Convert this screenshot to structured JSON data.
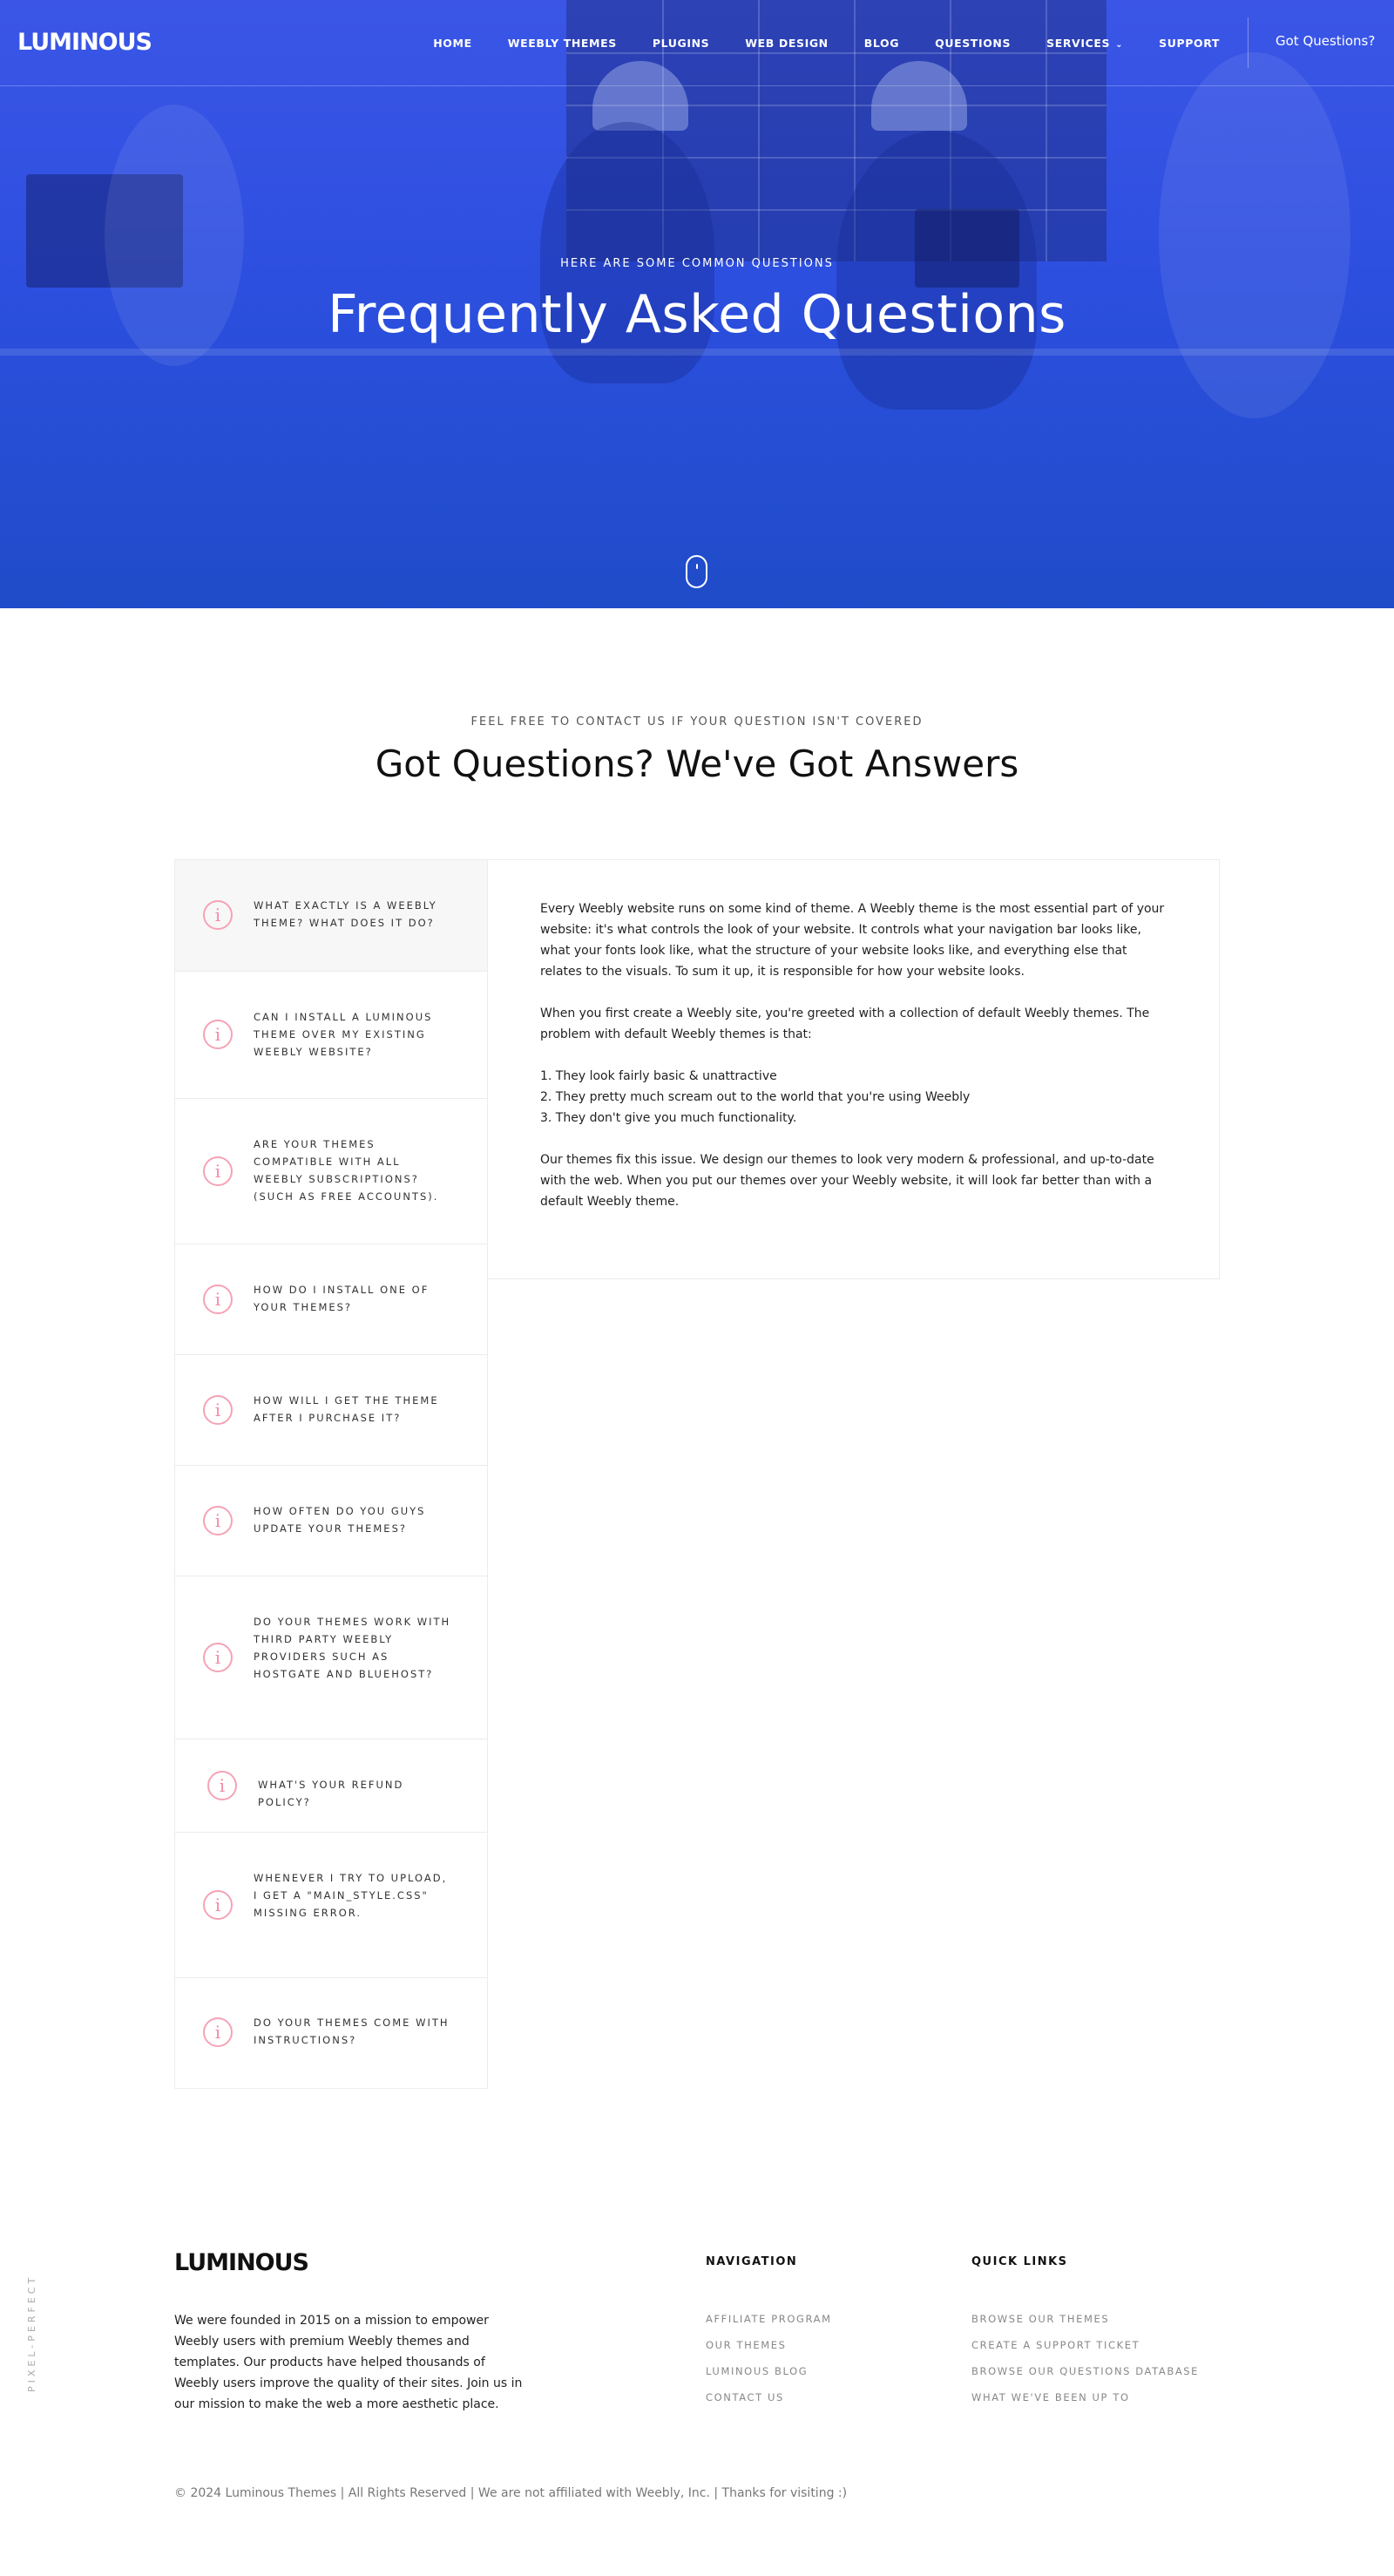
{
  "colors": {
    "hero_gradient_top": "#3b56e6",
    "hero_gradient_bottom": "#1f4cc8",
    "accent_icon": "#f28aa3",
    "text_dark": "#111111",
    "text_muted": "#888888"
  },
  "brand": {
    "logo_text": "LUMINOUS"
  },
  "nav": {
    "items": [
      {
        "label": "HOME"
      },
      {
        "label": "WEEBLY THEMES"
      },
      {
        "label": "PLUGINS"
      },
      {
        "label": "WEB DESIGN"
      },
      {
        "label": "BLOG"
      },
      {
        "label": "QUESTIONS"
      },
      {
        "label": "SERVICES",
        "icon": "chevron-down-icon"
      },
      {
        "label": "SUPPORT"
      }
    ],
    "cta": "Got Questions?"
  },
  "hero": {
    "eyebrow": "HERE ARE SOME COMMON QUESTIONS",
    "title": "Frequently Asked Questions",
    "scroll_icon": "mouse-scroll-icon"
  },
  "faq_section": {
    "eyebrow": "FEEL FREE TO CONTACT US IF YOUR QUESTION ISN'T COVERED",
    "title": "Got Questions? We've Got Answers",
    "item_icon": "info-icon",
    "questions": [
      {
        "text": "WHAT EXACTLY IS A WEEBLY THEME? WHAT DOES IT DO?",
        "active": true
      },
      {
        "text": "CAN I INSTALL A LUMINOUS THEME OVER MY EXISTING WEEBLY WEBSITE?",
        "active": false
      },
      {
        "text": "ARE YOUR THEMES COMPATIBLE WITH ALL WEEBLY SUBSCRIPTIONS? (SUCH AS FREE ACCOUNTS).",
        "active": false
      },
      {
        "text": "HOW DO I INSTALL ONE OF YOUR THEMES?",
        "active": false
      },
      {
        "text": "HOW WILL I GET THE THEME AFTER I PURCHASE IT?",
        "active": false
      },
      {
        "text": "HOW OFTEN DO YOU GUYS UPDATE YOUR THEMES?",
        "active": false
      },
      {
        "text": "DO YOUR THEMES WORK WITH THIRD PARTY WEEBLY PROVIDERS SUCH AS HOSTGATE AND BLUEHOST?",
        "active": false
      },
      {
        "text": "WHAT'S YOUR REFUND POLICY?",
        "active": false
      },
      {
        "text": "WHENEVER I TRY TO UPLOAD, I GET A \"MAIN_STYLE.CSS\" MISSING ERROR.",
        "active": false
      },
      {
        "text": "DO YOUR THEMES COME WITH INSTRUCTIONS?",
        "active": false
      }
    ],
    "answer": {
      "p1": "Every Weebly website runs on some kind of theme. A Weebly theme is the most essential part of your website: it's what controls the look of your website. It controls what your navigation bar looks like, what your fonts look like, what the structure of your website looks like, and everything else that relates to the visuals. To sum it up, it is responsible for how your website looks.",
      "p2": "When you first create a Weebly site, you're greeted with a collection of default Weebly themes. The problem with default Weebly themes is that:",
      "list": [
        "1. They look fairly basic & unattractive",
        "2. They pretty much scream out to the world that you're using Weebly",
        "3. They don't give you much functionality."
      ],
      "p3": "Our themes fix this issue. We design our themes to look very modern & professional, and up-to-date with the web. When you put our themes over your Weebly website, it will look far better than with a default Weebly theme."
    }
  },
  "footer": {
    "logo_text": "LUMINOUS",
    "about": "We were founded in 2015 on a mission to empower Weebly users with premium Weebly themes and templates. Our products have helped thousands of Weebly users improve the quality of their sites. Join us in our mission to make the web a more aesthetic place.",
    "navigation": {
      "title": "NAVIGATION",
      "links": [
        "AFFILIATE PROGRAM",
        "OUR THEMES",
        "LUMINOUS BLOG",
        "CONTACT US"
      ]
    },
    "quick_links": {
      "title": "QUICK LINKS",
      "links": [
        "BROWSE OUR THEMES",
        "CREATE A SUPPORT TICKET",
        "BROWSE OUR QUESTIONS DATABASE",
        "WHAT WE'VE BEEN UP TO"
      ]
    },
    "copyright": "© 2024 Luminous Themes | All Rights Reserved | We are not affiliated with Weebly, Inc. | Thanks for visiting :)",
    "side_tag": "PIXEL-PERFECT"
  }
}
